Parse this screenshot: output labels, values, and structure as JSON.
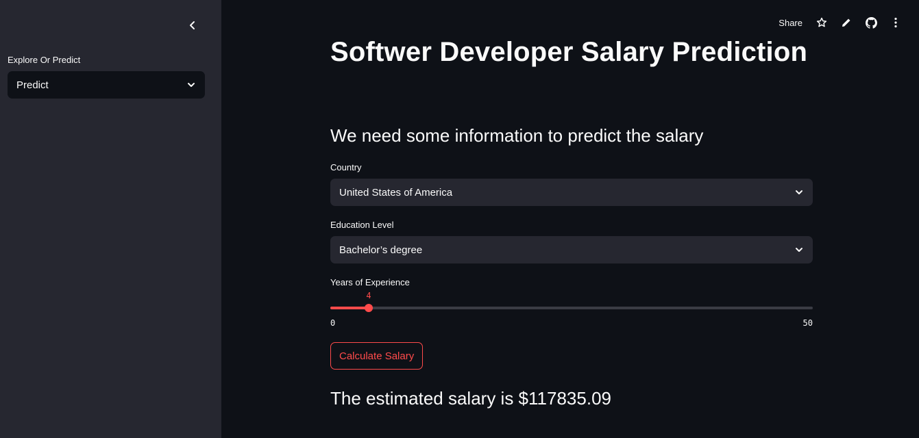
{
  "sidebar": {
    "collapse_icon": "chevron-left-icon",
    "mode_label": "Explore Or Predict",
    "mode_value": "Predict",
    "dropdown_icon": "chevron-down-icon"
  },
  "toolbar": {
    "share_label": "Share",
    "icons": [
      "star-icon",
      "pencil-icon",
      "github-icon",
      "more-vertical-icon"
    ]
  },
  "main": {
    "title": "Softwer Developer Salary Prediction",
    "subheader": "We need some information to predict the salary",
    "country": {
      "label": "Country",
      "value": "United States of America"
    },
    "education": {
      "label": "Education Level",
      "value": "Bachelor’s degree"
    },
    "experience": {
      "label": "Years of Experience",
      "value": 4,
      "min": 0,
      "max": 50
    },
    "calculate_label": "Calculate Salary",
    "result_text": "The estimated salary is $117835.09"
  },
  "colors": {
    "background": "#0e1117",
    "sidebar": "#262730",
    "accent": "#ff4b4b",
    "text": "#fafafa"
  }
}
